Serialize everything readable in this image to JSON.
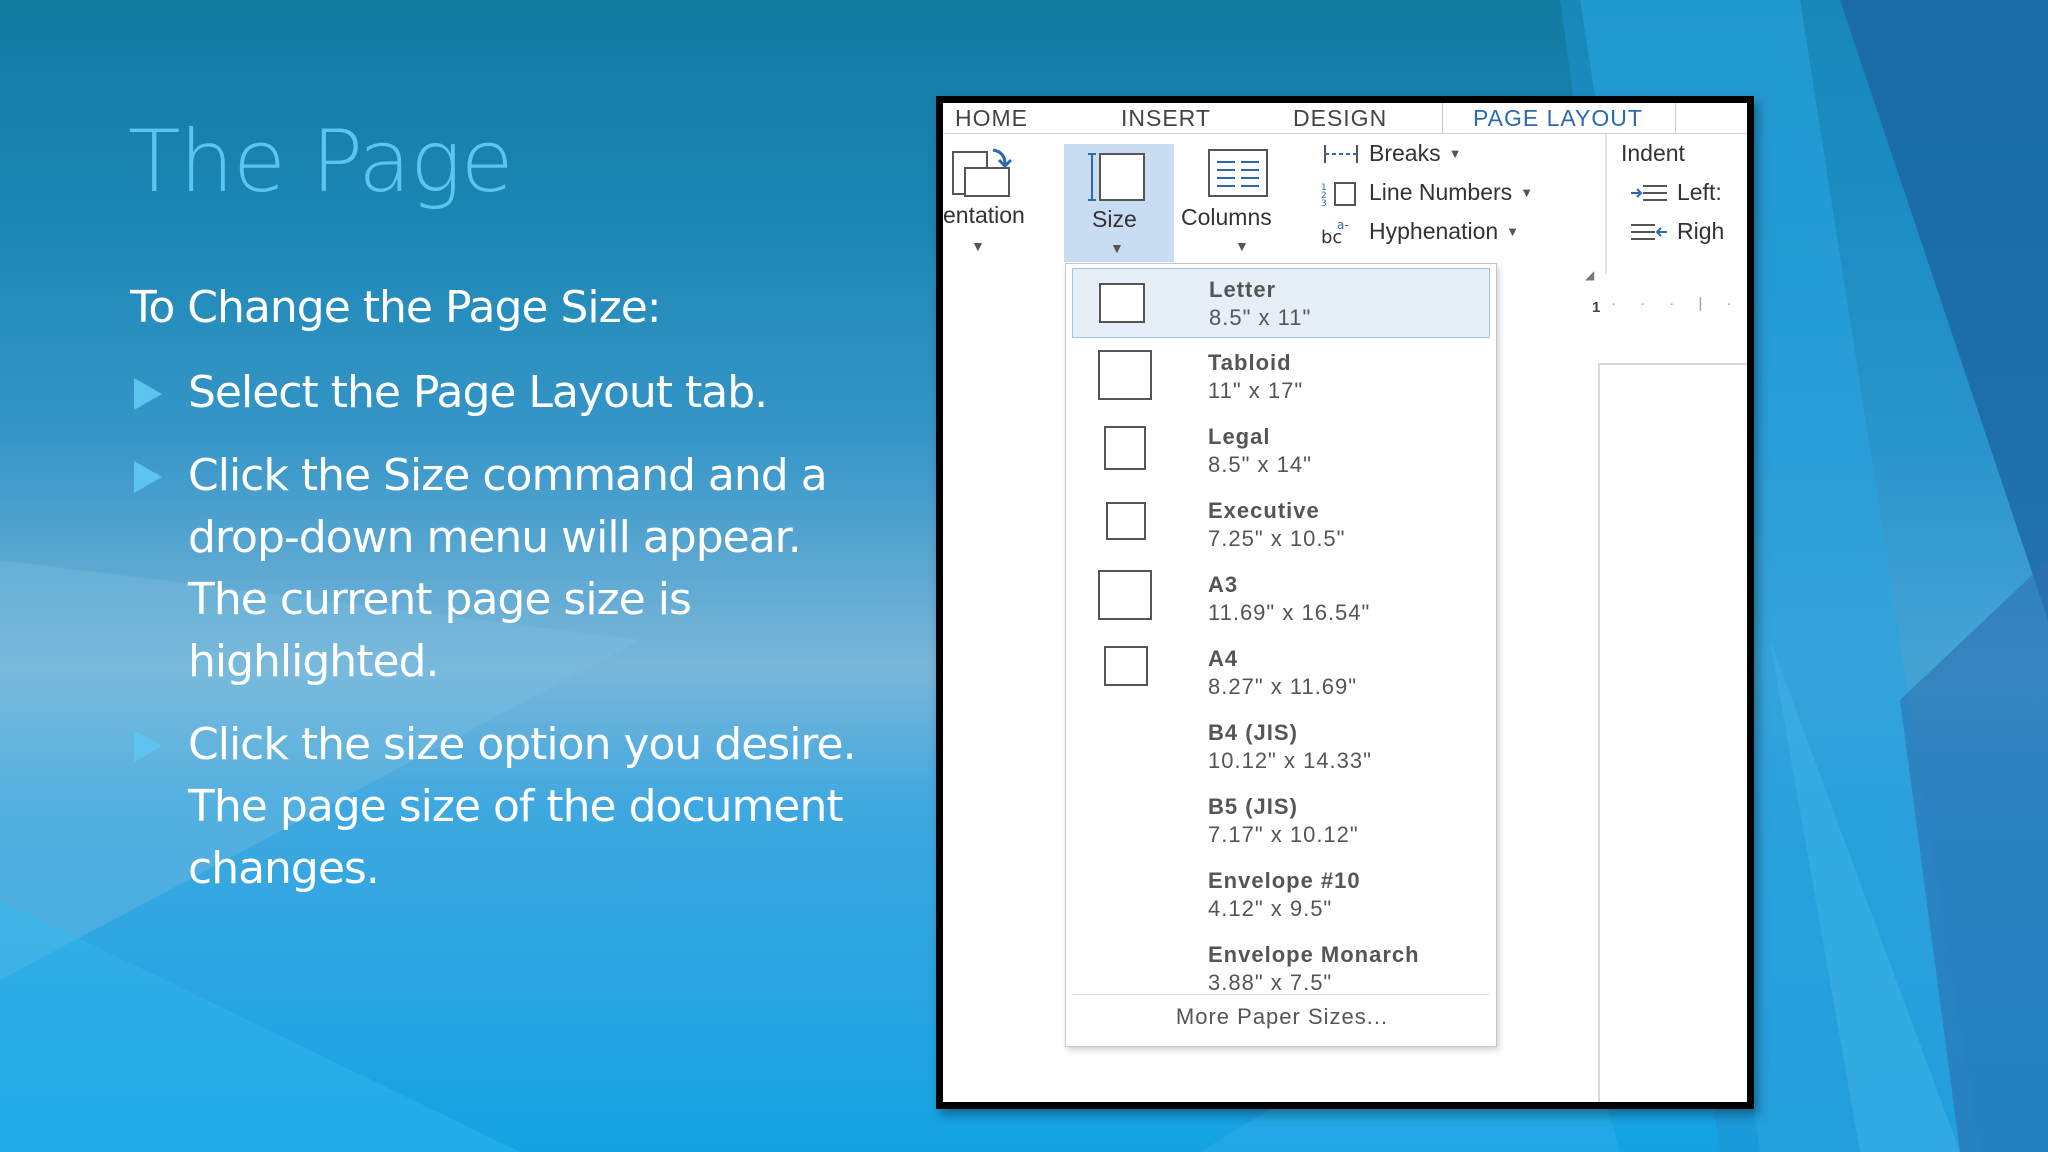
{
  "slide": {
    "title": "The Page",
    "intro": "To Change the Page Size:",
    "bullets": [
      "Select the Page Layout tab.",
      "Click the Size command and a drop-down menu will appear. The current page size is highlighted.",
      "Click the size option you desire. The page size of the document changes."
    ]
  },
  "ribbon": {
    "tabs": [
      "HOME",
      "INSERT",
      "DESIGN",
      "PAGE LAYOUT"
    ],
    "active_tab": "PAGE LAYOUT",
    "orientation_label": "entation",
    "size_label": "Size",
    "columns_label": "Columns",
    "breaks_label": "Breaks",
    "line_numbers_label": "Line Numbers",
    "hyphenation_label": "Hyphenation",
    "indent_label": "Indent",
    "indent_left_label": "Left:",
    "indent_right_label": "Righ",
    "ruler_number": "1"
  },
  "size_menu": {
    "options": [
      {
        "name": "Letter",
        "dims": "8.5\" x 11\"",
        "selected": true
      },
      {
        "name": "Tabloid",
        "dims": "11\" x 17\"",
        "selected": false
      },
      {
        "name": "Legal",
        "dims": "8.5\" x 14\"",
        "selected": false
      },
      {
        "name": "Executive",
        "dims": "7.25\" x 10.5\"",
        "selected": false
      },
      {
        "name": "A3",
        "dims": "11.69\" x 16.54\"",
        "selected": false
      },
      {
        "name": "A4",
        "dims": "8.27\" x 11.69\"",
        "selected": false
      },
      {
        "name": "B4 (JIS)",
        "dims": "10.12\" x 14.33\"",
        "selected": false
      },
      {
        "name": "B5 (JIS)",
        "dims": "7.17\" x 10.12\"",
        "selected": false
      },
      {
        "name": "Envelope #10",
        "dims": "4.12\" x 9.5\"",
        "selected": false
      },
      {
        "name": "Envelope Monarch",
        "dims": "3.88\" x 7.5\"",
        "selected": false
      }
    ],
    "more_label": "More Paper Sizes..."
  },
  "colors": {
    "title": "#5cc4ee",
    "accent": "#5cc4ee",
    "active_tab": "#2b6ab0",
    "selected_bg": "#c8dcf2"
  },
  "icons": [
    "right-arrow-bullet-icon",
    "orientation-icon",
    "size-icon",
    "columns-icon",
    "breaks-icon",
    "line-numbers-icon",
    "hyphenation-icon",
    "indent-left-icon",
    "indent-right-icon",
    "dialog-launcher-icon"
  ]
}
